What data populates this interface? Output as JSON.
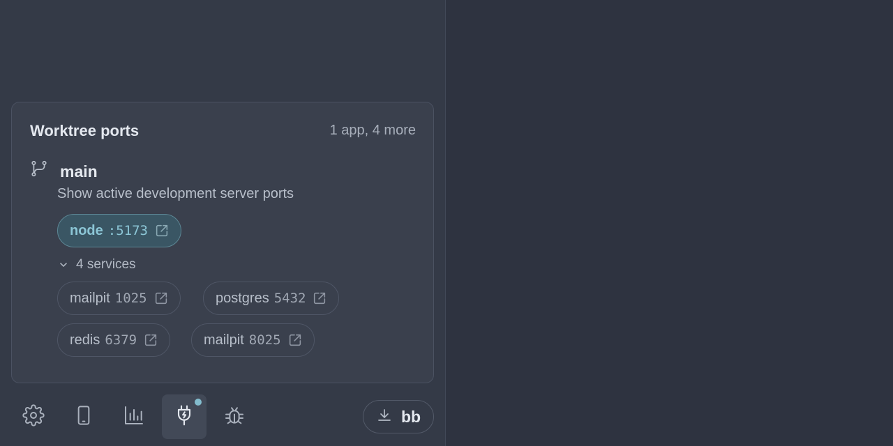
{
  "panel": {
    "title": "Worktree ports",
    "summary": "1 app, 4 more"
  },
  "worktree": {
    "branch_icon": "git-branch-icon",
    "name": "main",
    "description": "Show active development server ports",
    "app": {
      "name": "node",
      "port": ":5173",
      "icon": "external-link-icon"
    },
    "services_label": "4 services",
    "services": [
      {
        "name": "mailpit",
        "port": "1025"
      },
      {
        "name": "postgres",
        "port": "5432"
      },
      {
        "name": "redis",
        "port": "6379"
      },
      {
        "name": "mailpit",
        "port": "8025"
      }
    ]
  },
  "toolbar": {
    "items": [
      {
        "icon": "gear-icon"
      },
      {
        "icon": "smartphone-icon"
      },
      {
        "icon": "bar-chart-icon"
      },
      {
        "icon": "plug-icon",
        "active": true,
        "has_notification": true
      },
      {
        "icon": "bug-icon"
      }
    ],
    "download_icon": "download-icon",
    "download_label": "bb"
  },
  "colors": {
    "accent": "#8cc6d6",
    "sidebar_bg": "#343a47",
    "main_bg": "#2e3340",
    "card_bg": "#3a404d"
  }
}
